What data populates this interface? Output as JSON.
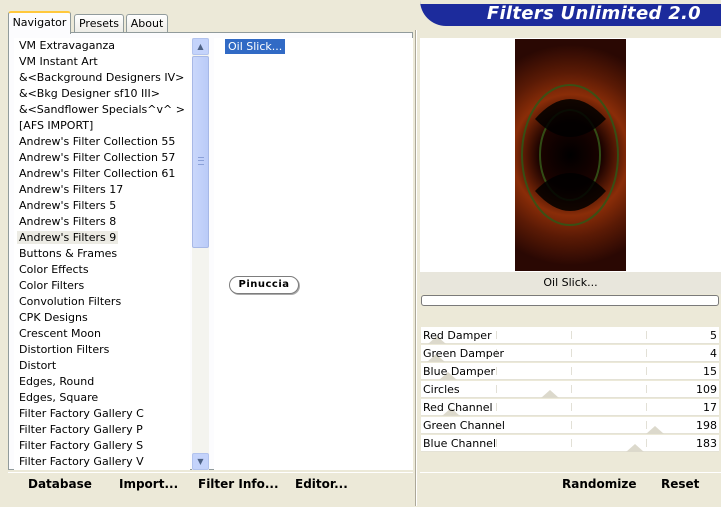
{
  "tabs": [
    {
      "label": "Navigator",
      "active": true
    },
    {
      "label": "Presets",
      "active": false
    },
    {
      "label": "About",
      "active": false
    }
  ],
  "banner_title": "Filters Unlimited 2.0",
  "categories": [
    "VM Extravaganza",
    "VM Instant Art",
    "&<Background Designers IV>",
    "&<Bkg Designer sf10 III>",
    "&<Sandflower Specials^v^ >",
    "[AFS IMPORT]",
    "Andrew's Filter Collection 55",
    "Andrew's Filter Collection 57",
    "Andrew's Filter Collection 61",
    "Andrew's Filters 17",
    "Andrew's Filters 5",
    "Andrew's Filters 8",
    "Andrew's Filters 9",
    "Buttons & Frames",
    "Color Effects",
    "Color Filters",
    "Convolution Filters",
    "CPK Designs",
    "Crescent Moon",
    "Distortion Filters",
    "Distort",
    "Edges, Round",
    "Edges, Square",
    "Filter Factory Gallery C",
    "Filter Factory Gallery P",
    "Filter Factory Gallery S",
    "Filter Factory Gallery V"
  ],
  "selected_category": "Andrew's Filters 9",
  "filters": [
    "Oil Slick..."
  ],
  "selected_filter": "Oil Slick...",
  "watermark": "Pinuccia",
  "preview_filter_name": "Oil Slick...",
  "progress": 0,
  "sliders": [
    {
      "label": "Red Damper",
      "value": 5
    },
    {
      "label": "Green Damper",
      "value": 4
    },
    {
      "label": "Blue Damper",
      "value": 15
    },
    {
      "label": "Circles",
      "value": 109
    },
    {
      "label": "Red Channel",
      "value": 17
    },
    {
      "label": "Green Channel",
      "value": 198
    },
    {
      "label": "Blue Channel",
      "value": 183
    }
  ],
  "buttons": {
    "database": "Database",
    "import": "Import...",
    "filter_info": "Filter Info...",
    "editor": "Editor...",
    "randomize": "Randomize",
    "reset": "Reset"
  },
  "icons": {
    "scroll_up": "scroll-up-arrow-icon",
    "scroll_down": "scroll-down-arrow-icon"
  },
  "colors": {
    "banner": "#1c2b9c",
    "selection": "#316ac5",
    "tab_highlight": "#ffc83c"
  }
}
